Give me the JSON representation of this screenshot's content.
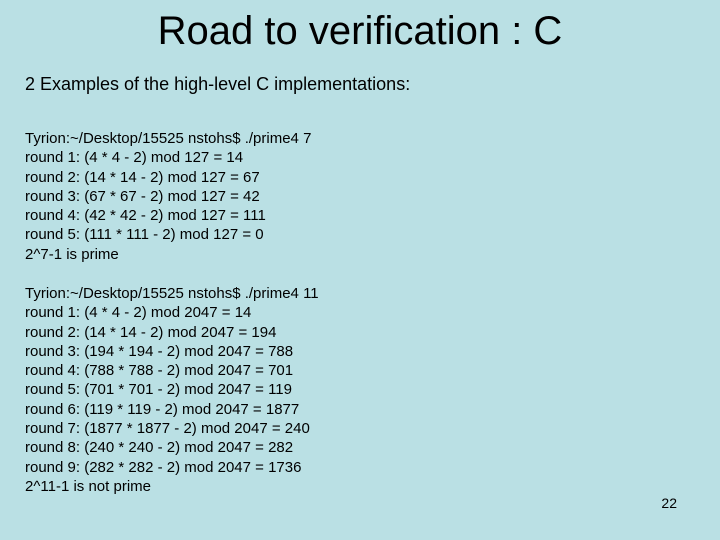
{
  "slide": {
    "title": "Road to verification : C",
    "subtitle": "2 Examples of the high-level C implementations:",
    "examples": [
      {
        "command": "Tyrion:~/Desktop/15525 nstohs$ ./prime4 7",
        "rounds": [
          "round 1: (4 * 4 - 2) mod 127 = 14",
          "round 2: (14 * 14 - 2) mod 127 = 67",
          "round 3: (67 * 67 - 2) mod 127 = 42",
          "round 4: (42 * 42 - 2) mod 127 = 111",
          "round 5: (111 * 111 - 2) mod 127 = 0"
        ],
        "result": "2^7-1 is prime"
      },
      {
        "command": "Tyrion:~/Desktop/15525 nstohs$ ./prime4 11",
        "rounds": [
          "round 1: (4 * 4 - 2) mod 2047 = 14",
          "round 2: (14 * 14 - 2) mod 2047 = 194",
          "round 3: (194 * 194 - 2) mod 2047 = 788",
          "round 4: (788 * 788 - 2) mod 2047 = 701",
          "round 5: (701 * 701 - 2) mod 2047 = 119",
          "round 6: (119 * 119 - 2) mod 2047 = 1877",
          "round 7: (1877 * 1877 - 2) mod 2047 = 240",
          "round 8: (240 * 240 - 2) mod 2047 = 282",
          "round 9: (282 * 282 - 2) mod 2047 = 1736"
        ],
        "result": "2^11-1 is not prime"
      }
    ],
    "page_number": "22"
  }
}
